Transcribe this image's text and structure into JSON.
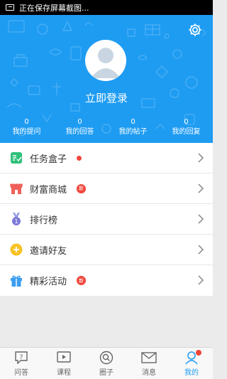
{
  "status_bar": {
    "text": "正在保存屏幕截图..."
  },
  "profile": {
    "login_text": "立即登录",
    "stats": [
      {
        "value": "0",
        "label": "我的提问"
      },
      {
        "value": "0",
        "label": "我的回答"
      },
      {
        "value": "0",
        "label": "我的帖子"
      },
      {
        "value": "0",
        "label": "我的回复"
      }
    ]
  },
  "menu": [
    {
      "label": "任务盒子",
      "icon": "task-box-icon",
      "badge": "dot"
    },
    {
      "label": "财富商城",
      "icon": "shop-icon",
      "badge": "新"
    },
    {
      "label": "排行榜",
      "icon": "medal-icon",
      "badge": ""
    },
    {
      "label": "邀请好友",
      "icon": "invite-plus-icon",
      "badge": ""
    },
    {
      "label": "精彩活动",
      "icon": "gift-icon",
      "badge": "新"
    }
  ],
  "tabs": [
    {
      "label": "问答",
      "icon": "question-icon",
      "active": false
    },
    {
      "label": "课程",
      "icon": "play-icon",
      "active": false
    },
    {
      "label": "圈子",
      "icon": "circle-icon",
      "active": false
    },
    {
      "label": "消息",
      "icon": "mail-icon",
      "active": false
    },
    {
      "label": "我的",
      "icon": "person-icon",
      "active": true
    }
  ],
  "colors": {
    "brand_blue": "#1e9cf2",
    "badge_red": "#f0453a",
    "task_green": "#2fc07a",
    "shop_red": "#f0605a",
    "medal_purple": "#7b7bd6",
    "invite_yellow": "#f7c325",
    "gift_blue": "#3b9df0"
  }
}
